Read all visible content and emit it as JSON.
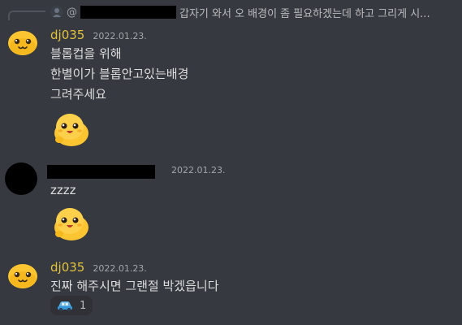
{
  "reply_context": {
    "mention_prefix": "@",
    "text": "갑자기 와서 오 배경이 좀 필요하겠는데 하고 그리게 시..."
  },
  "messages": [
    {
      "username": "dj035",
      "timestamp": "2022.01.23.",
      "lines": [
        "블롭컵을 위해",
        "한별이가 블롭안고있는배경",
        "그려주세요"
      ],
      "sticker": "blob-happy-sticker"
    },
    {
      "username": "",
      "timestamp": "2022.01.23.",
      "lines": [
        "zzzz"
      ],
      "sticker": "blob-happy-sticker"
    },
    {
      "username": "dj035",
      "timestamp": "2022.01.23.",
      "lines": [
        "진짜 해주시면 그랜절 박겠읍니다"
      ],
      "reaction": {
        "emoji": "car-emoji",
        "count": "1"
      }
    }
  ],
  "colors": {
    "background": "#36393f",
    "username": "#e3c23b",
    "timestamp": "#a3a6aa",
    "text": "#dcddde",
    "reaction_bg": "#2f3136",
    "blob_yellow": "#fbc531"
  }
}
